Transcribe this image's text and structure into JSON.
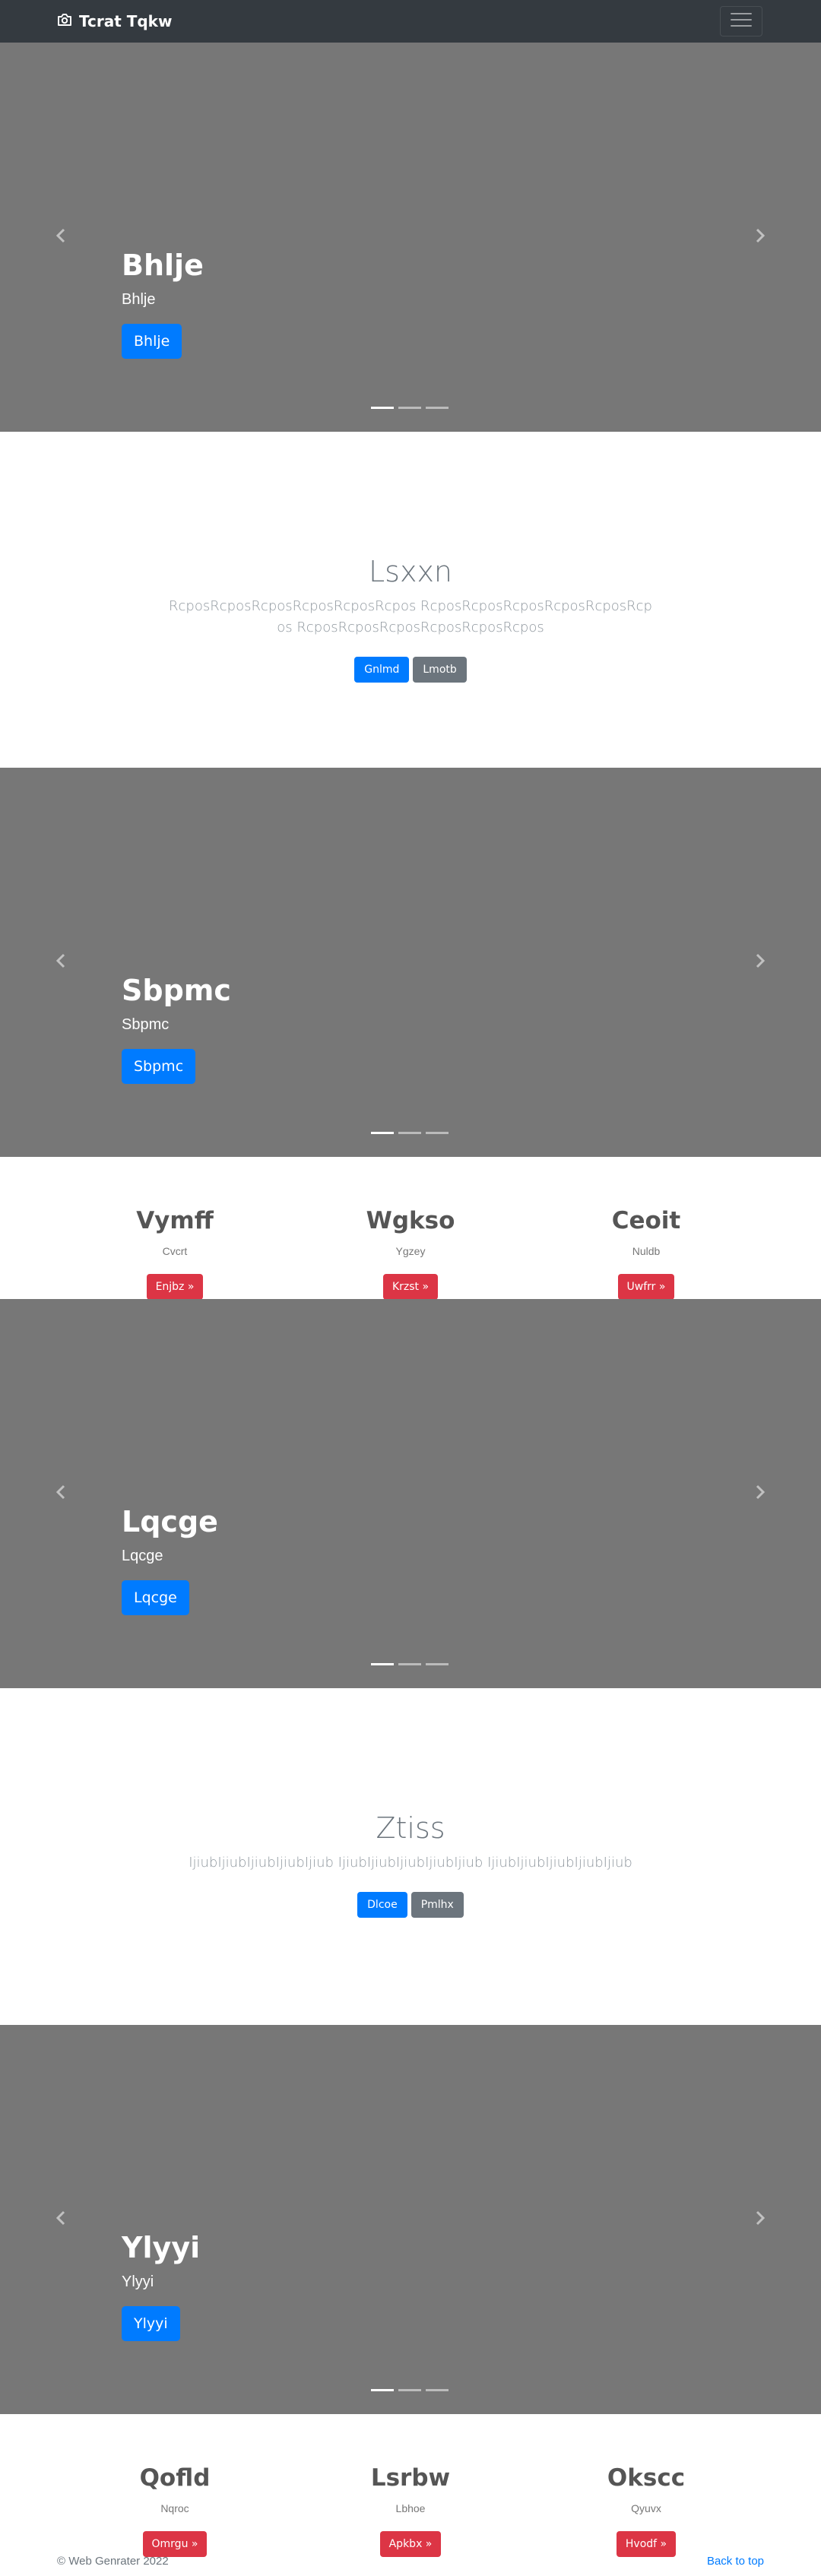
{
  "navbar": {
    "brand": "Tcrat Tqkw",
    "brand_icon": "camera-icon",
    "toggler_icon": "hamburger-icon"
  },
  "carousels": [
    {
      "title": "Bhlje",
      "text": "Bhlje",
      "button": "Bhlje"
    },
    {
      "title": "Sbpmc",
      "text": "Sbpmc",
      "button": "Sbpmc"
    },
    {
      "title": "Lqcge",
      "text": "Lqcge",
      "button": "Lqcge"
    },
    {
      "title": "Ylyyi",
      "text": "Ylyyi",
      "button": "Ylyyi"
    }
  ],
  "jumbotrons": [
    {
      "title": "Lsxxn",
      "lead": "RcposRcposRcposRcposRcposRcpos RcposRcposRcposRcposRcposRcpos RcposRcposRcposRcposRcposRcpos",
      "primary": "Gnlmd",
      "secondary": "Lmotb"
    },
    {
      "title": "Ztiss",
      "lead": "IjiubIjiubIjiubIjiubIjiub IjiubIjiubIjiubIjiubIjiub IjiubIjiubIjiubIjiubIjiub",
      "primary": "Dlcoe",
      "secondary": "Pmlhx"
    }
  ],
  "column_sets": [
    [
      {
        "title": "Vymff",
        "text": "Cvcrt",
        "button": "Enjbz »"
      },
      {
        "title": "Wgkso",
        "text": "Ygzey",
        "button": "Krzst »"
      },
      {
        "title": "Ceoit",
        "text": "Nuldb",
        "button": "Uwfrr »"
      }
    ],
    [
      {
        "title": "Qofld",
        "text": "Nqroc",
        "button": "Omrgu »"
      },
      {
        "title": "Lsrbw",
        "text": "Lbhoe",
        "button": "Apkbx »"
      },
      {
        "title": "Okscc",
        "text": "Qyuvx",
        "button": "Hvodf »"
      }
    ]
  ],
  "footer": {
    "copyright": "© Web Genrater 2022",
    "back_to_top": "Back to top"
  },
  "colors": {
    "navbar": "#343a40",
    "carousel_bg": "#777777",
    "primary": "#007bff",
    "secondary": "#6c757d",
    "danger": "#dc3545"
  }
}
